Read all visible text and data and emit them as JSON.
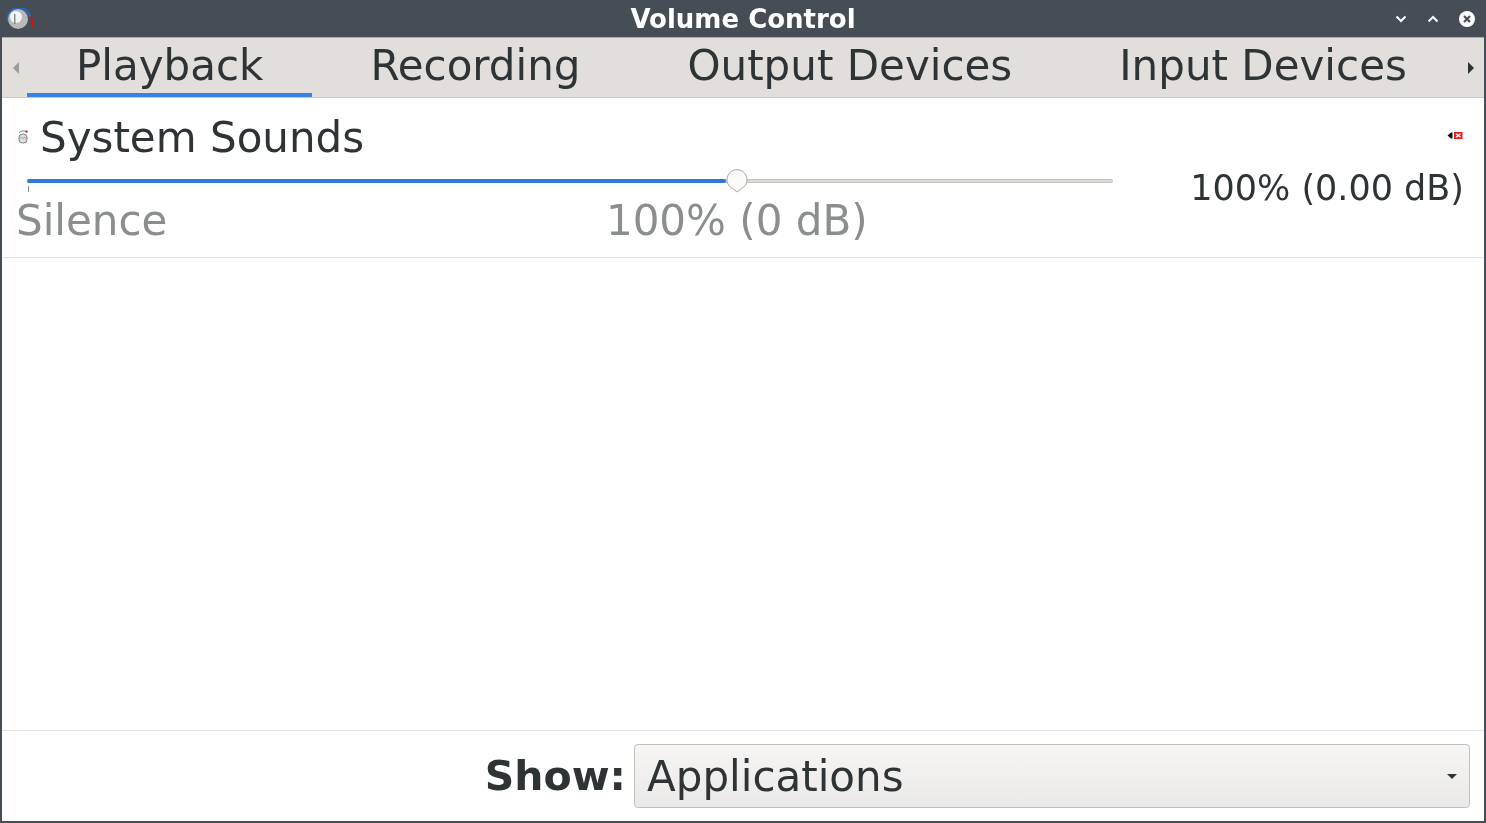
{
  "window": {
    "title": "Volume Control"
  },
  "tab_scroll": [
    {
      "kind": "back",
      "disabled": true
    },
    {
      "kind": "forward",
      "disabled": false
    }
  ],
  "tabs": [
    {
      "label": "Playback",
      "selected": true
    },
    {
      "label": "Recording",
      "selected": false
    },
    {
      "label": "Output Devices",
      "selected": false
    },
    {
      "label": "Input Devices",
      "selected": false
    }
  ],
  "streams": [
    {
      "name": "System Sounds",
      "level": 0.654,
      "reading": "100% (0.00 dB)",
      "marks": [
        {
          "kind": "silence",
          "label": "Silence"
        },
        {
          "kind": "norm",
          "label": "100% (0 dB)"
        }
      ]
    }
  ],
  "footer": {
    "label": "Show:",
    "dropdown": {
      "value": "Applications"
    }
  }
}
